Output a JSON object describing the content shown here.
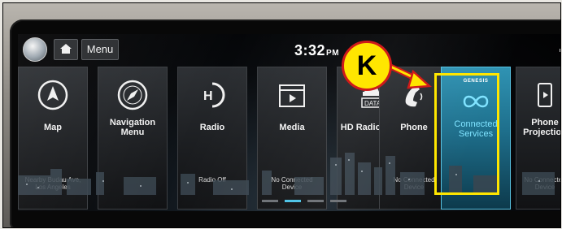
{
  "header": {
    "menu_label": "Menu",
    "time": "3:32",
    "ampm": "PM"
  },
  "tiles": [
    {
      "label": "Map",
      "sub": "Nearby Budau Ave,\nLos Angeles",
      "icon": "map-compass-icon"
    },
    {
      "label": "Navigation\nMenu",
      "sub": "",
      "icon": "navigation-compass-icon"
    },
    {
      "label": "Radio",
      "sub": "Radio Off",
      "icon": "hd-radio-icon"
    },
    {
      "label": "Media",
      "sub": "No Connected\nDevice",
      "icon": "media-play-icon"
    },
    {
      "label": "HD Radio Data",
      "sub": "",
      "icon": "hd-data-icon"
    },
    {
      "label": "Phone",
      "sub": "No Connected\nDevice",
      "icon": "phone-icon"
    },
    {
      "label": "Connected\nServices",
      "sub": "",
      "icon": "genesis-infinity-icon",
      "brand": "GENESIS"
    },
    {
      "label": "Phone\nProjection",
      "sub": "No Connected\nDevice",
      "icon": "phone-projection-icon"
    }
  ],
  "annotation": {
    "callout_letter": "K",
    "highlight_color": "#ffe600",
    "callout_border_color": "#cf1a1a"
  },
  "colors": {
    "accent": "#49c2e6",
    "tile_bg": "#1c1e21"
  }
}
